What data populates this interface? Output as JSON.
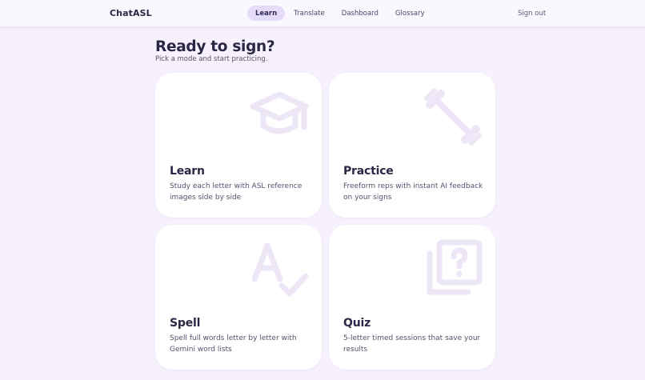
{
  "header": {
    "brand": "ChatASL",
    "nav": [
      {
        "label": "Learn",
        "active": true
      },
      {
        "label": "Translate",
        "active": false
      },
      {
        "label": "Dashboard",
        "active": false
      },
      {
        "label": "Glossary",
        "active": false
      }
    ],
    "signout": "Sign out"
  },
  "main": {
    "title": "Ready to sign?",
    "subtitle": "Pick a mode and start practicing.",
    "cards": [
      {
        "title": "Learn",
        "description": "Study each letter with ASL reference images side by side",
        "icon": "graduation-cap-icon"
      },
      {
        "title": "Practice",
        "description": "Freeform reps with instant AI feedback on your signs",
        "icon": "dumbbell-icon"
      },
      {
        "title": "Spell",
        "description": "Spell full words letter by letter with Gemini word lists",
        "icon": "spellcheck-icon"
      },
      {
        "title": "Quiz",
        "description": "5-letter timed sessions that save your results",
        "icon": "quiz-icon"
      }
    ]
  },
  "colors": {
    "background": "#f6f1fd",
    "card": "#ffffff",
    "active_tab": "#e4dcf8",
    "icon": "#ece6f6",
    "text": "#2a2744"
  }
}
